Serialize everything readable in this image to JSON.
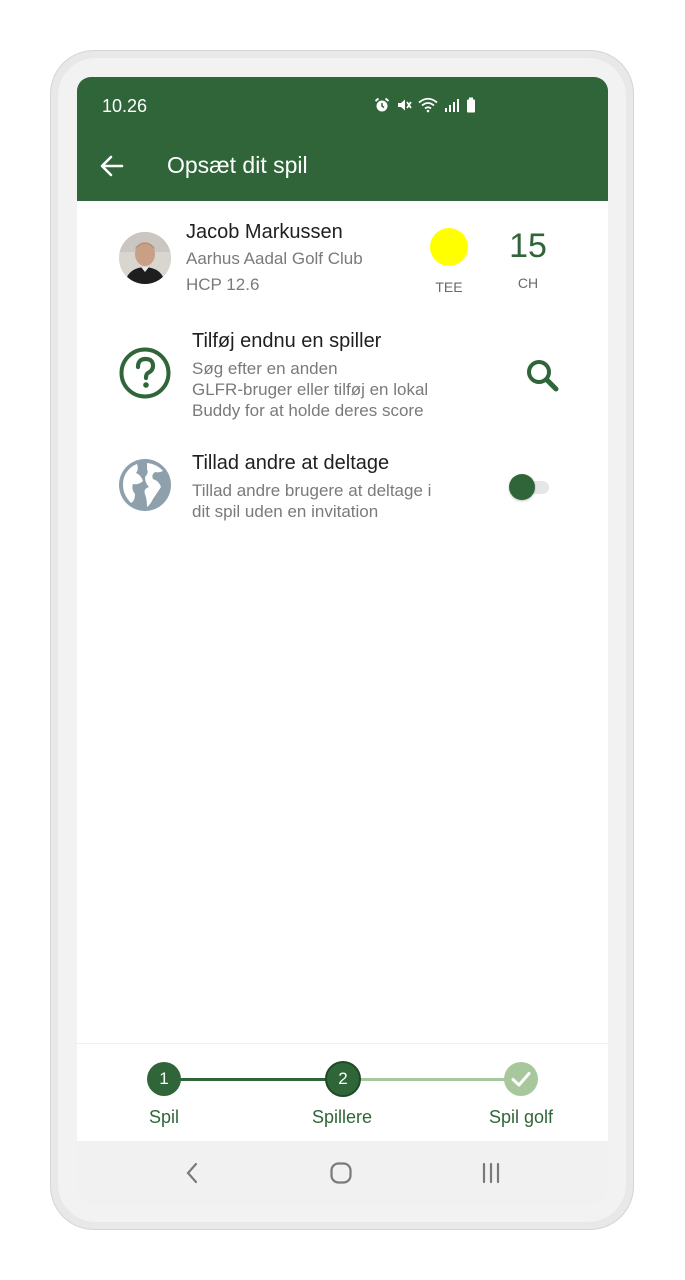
{
  "status": {
    "time": "10.26"
  },
  "header": {
    "title": "Opsæt dit spil"
  },
  "player": {
    "name": "Jacob Markussen",
    "club": "Aarhus Aadal Golf Club",
    "hcp": "HCP 12.6",
    "tee_label": "TEE",
    "tee_color": "#ffff00",
    "ch_value": "15",
    "ch_label": "CH"
  },
  "add_player": {
    "title": "Tilføj endnu en spiller",
    "desc_line1": "Søg efter en anden",
    "desc_line2": "GLFR-bruger eller tilføj en lokal",
    "desc_line3": "Buddy for at holde deres score"
  },
  "allow_join": {
    "title": "Tillad andre at deltage",
    "desc_line1": "Tillad andre brugere at deltage i",
    "desc_line2": "dit spil uden en invitation",
    "enabled": false
  },
  "stepper": {
    "steps": [
      {
        "number": "1",
        "label": "Spil"
      },
      {
        "number": "2",
        "label": "Spillere"
      },
      {
        "number": "",
        "label": "Spil golf"
      }
    ],
    "active_step": 2
  },
  "colors": {
    "brand_green": "#2f6539",
    "light_green": "#a9c79c",
    "globe_gray": "#8fa0ad"
  }
}
